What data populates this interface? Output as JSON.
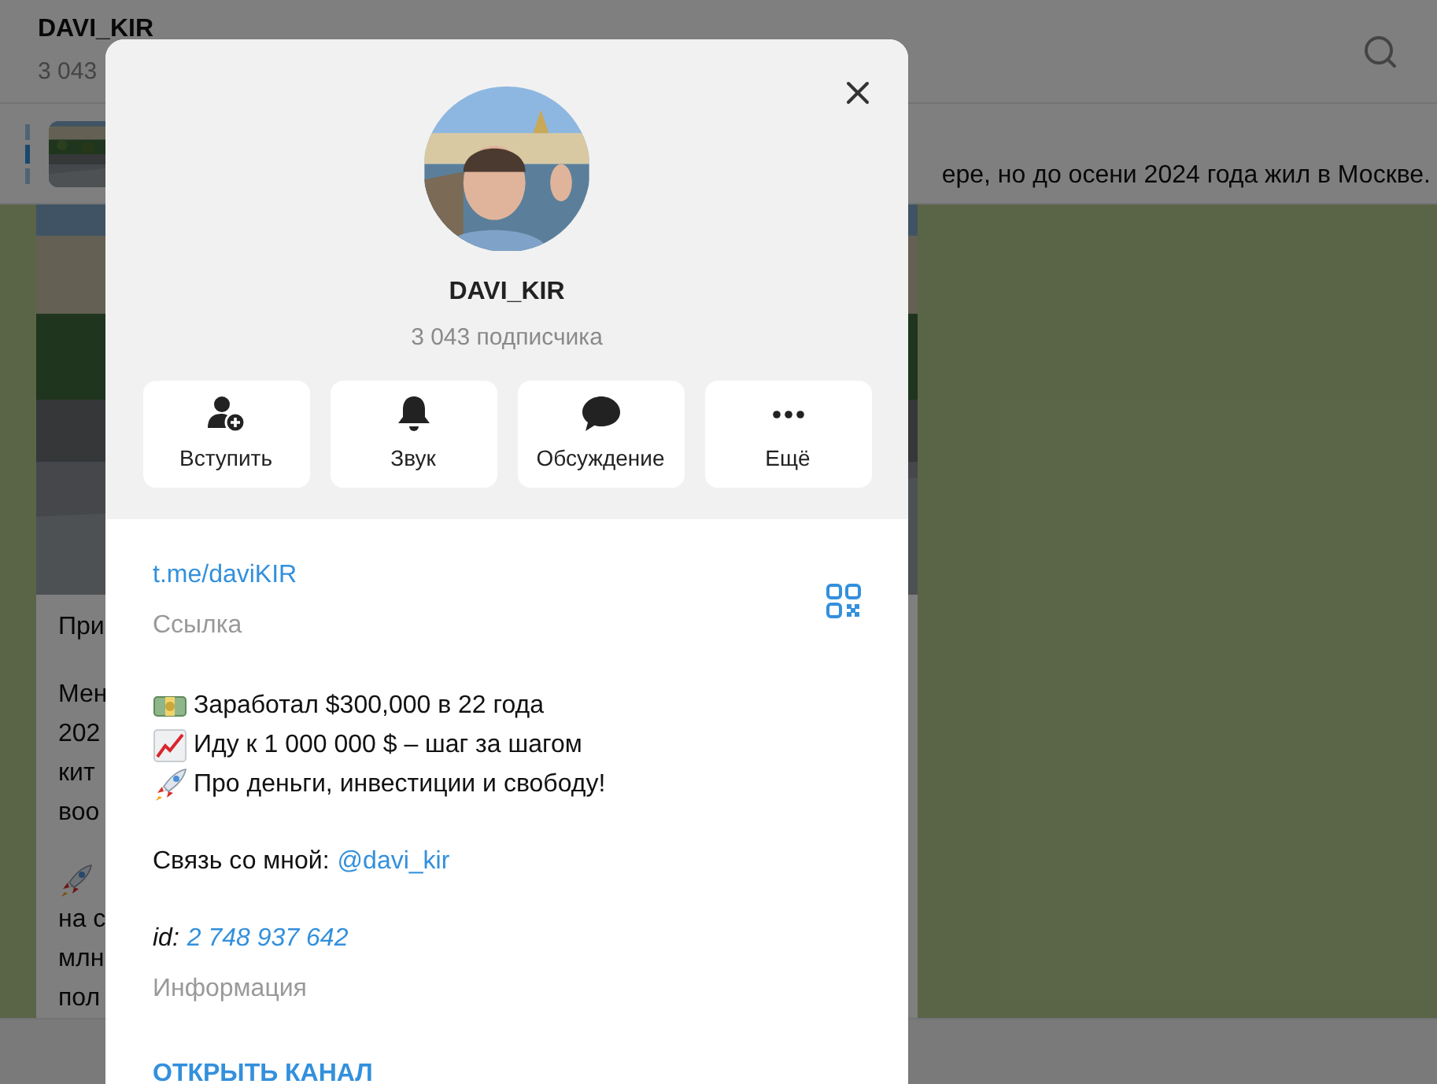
{
  "chat_header": {
    "title": "DAVI_KIR",
    "subtitle": "3 043"
  },
  "pinned": {
    "text": "ере, но до осени 2024 года жил в Москве."
  },
  "message": {
    "paragraphs": [
      {
        "lines": [
          "При"
        ]
      },
      {
        "lines": [
          "Мен",
          "202",
          "кит",
          "воо"
        ]
      },
      {
        "kind": "rocket",
        "lines": [
          "на с",
          "млн",
          "пол"
        ]
      }
    ]
  },
  "profile": {
    "name": "DAVI_KIR",
    "subscribers": "3 043 подписчика",
    "actions": [
      {
        "kind": "join",
        "label": "Вступить"
      },
      {
        "kind": "bell",
        "label": "Звук"
      },
      {
        "kind": "chat",
        "label": "Обсуждение"
      },
      {
        "kind": "more",
        "label": "Ещё"
      }
    ],
    "link": {
      "value": "t.me/daviKIR",
      "caption": "Ссылка"
    },
    "description": [
      {
        "kind": "money",
        "text": "Заработал $300,000 в 22 года"
      },
      {
        "kind": "chart",
        "text": "Иду к 1 000 000 $ – шаг за шагом"
      },
      {
        "kind": "rocket",
        "text": "Про деньги, инвестиции и свободу!"
      }
    ],
    "contact": {
      "label": "Связь со мной:",
      "handle": "@davi_kir"
    },
    "id": {
      "label": "id:",
      "value": "2 748 937 642",
      "caption": "Информация"
    },
    "open_button": "ОТКРЫТЬ КАНАЛ"
  }
}
